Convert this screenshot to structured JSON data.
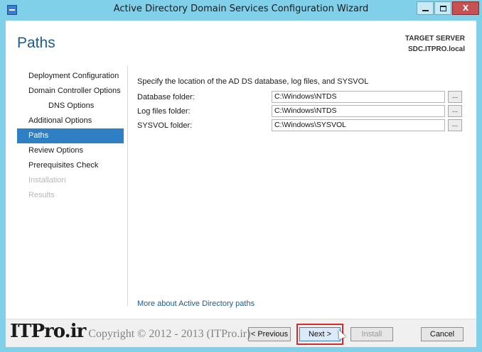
{
  "window": {
    "title": "Active Directory Domain Services Configuration Wizard",
    "close_glyph": "X"
  },
  "header": {
    "page_title": "Paths",
    "target_server_label": "TARGET SERVER",
    "target_server_name": "SDC.ITPRO.local"
  },
  "nav": {
    "items": [
      {
        "label": "Deployment Configuration",
        "state": "normal"
      },
      {
        "label": "Domain Controller Options",
        "state": "normal"
      },
      {
        "label": "DNS Options",
        "state": "sub"
      },
      {
        "label": "Additional Options",
        "state": "normal"
      },
      {
        "label": "Paths",
        "state": "active"
      },
      {
        "label": "Review Options",
        "state": "normal"
      },
      {
        "label": "Prerequisites Check",
        "state": "normal"
      },
      {
        "label": "Installation",
        "state": "disabled"
      },
      {
        "label": "Results",
        "state": "disabled"
      }
    ]
  },
  "content": {
    "instruction": "Specify the location of the AD DS database, log files, and SYSVOL",
    "fields": [
      {
        "label": "Database folder:",
        "value": "C:\\Windows\\NTDS"
      },
      {
        "label": "Log files folder:",
        "value": "C:\\Windows\\NTDS"
      },
      {
        "label": "SYSVOL folder:",
        "value": "C:\\Windows\\SYSVOL"
      }
    ],
    "browse_label": "...",
    "more_link": "More about Active Directory paths"
  },
  "buttons": {
    "previous": "< Previous",
    "next": "Next >",
    "install": "Install",
    "cancel": "Cancel"
  },
  "watermark": {
    "logo": "ITPro.ir",
    "text": "Copyright © 2012 - 2013 (ITPro.ir)"
  }
}
